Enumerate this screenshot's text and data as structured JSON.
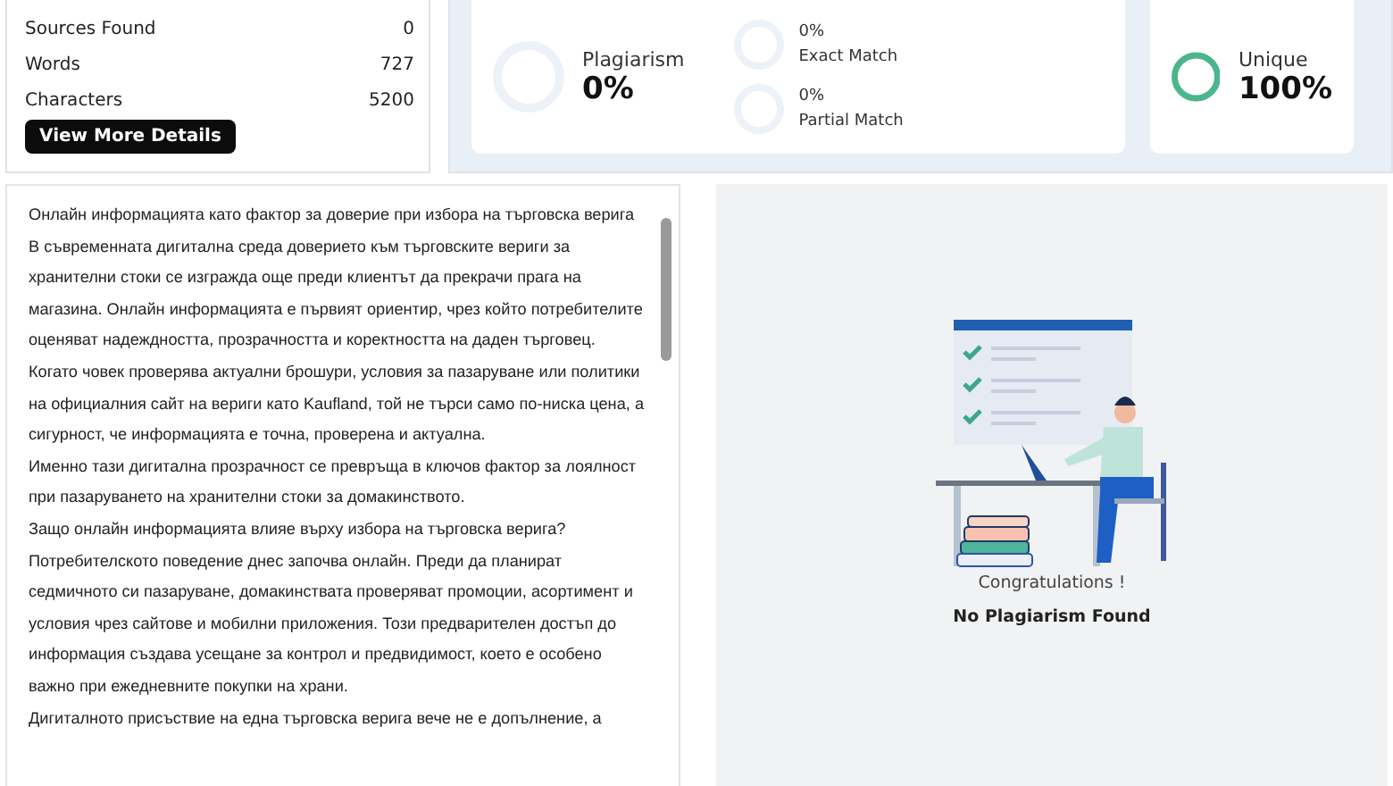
{
  "scan_properties": {
    "rows": [
      {
        "label": "Sources Found",
        "value": "0"
      },
      {
        "label": "Words",
        "value": "727"
      },
      {
        "label": "Characters",
        "value": "5200"
      }
    ],
    "button": "View More Details"
  },
  "plagiarism": {
    "label": "Plagiarism",
    "value": "0%",
    "level": 0
  },
  "matches": [
    {
      "value": "0%",
      "label": "Exact Match",
      "level": 0
    },
    {
      "value": "0%",
      "label": "Partial Match",
      "level": 0
    }
  ],
  "unique": {
    "label": "Unique",
    "value": "100%",
    "level": 1
  },
  "document": {
    "paragraphs": [
      "Онлайн информацията като фактор за доверие при избора на търговска верига",
      "В съвременната дигитална среда доверието към търговските вериги за хранителни стоки се изгражда още преди клиентът да прекрачи прага на магазина. Онлайн информацията е първият ориентир, чрез който потребителите оценяват надеждността, прозрачността и коректността на даден търговец. Когато човек проверява актуални брошури, условия за пазаруване или политики на официалния сайт на вериги като Kaufland, той не търси само по-ниска цена, а сигурност, че информацията е точна, проверена и актуална.",
      "Именно тази дигитална прозрачност се превръща в ключов фактор за лоялност при пазаруването на хранителни стоки за домакинството.",
      "Защо онлайн информацията влияе върху избора на търговска верига?",
      "Потребителското поведение днес започва онлайн. Преди да планират седмичното си пазаруване, домакинствата проверяват промоции, асортимент и условия чрез сайтове и мобилни приложения. Този предварителен достъп до информация създава усещане за контрол и предвидимост, което е особено важно при ежедневните покупки на храни.",
      "Дигиталното присъствие на една търговска верига вече не е допълнение, а"
    ]
  },
  "result": {
    "title": "Congratulations !",
    "message": "No Plagiarism Found"
  }
}
